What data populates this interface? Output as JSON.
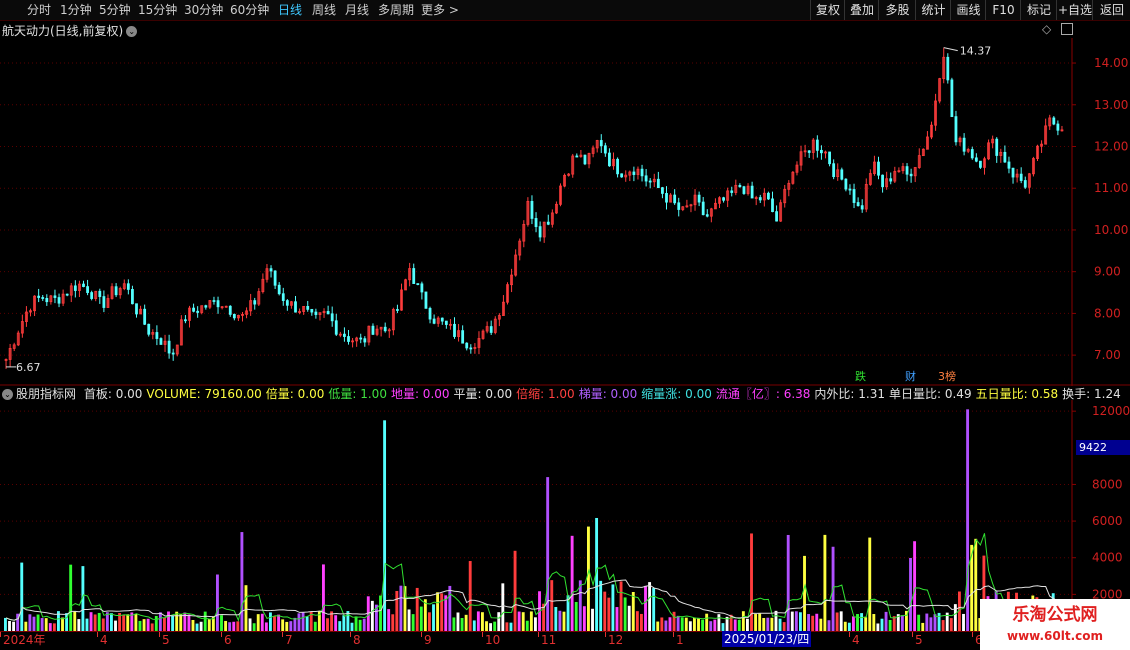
{
  "toolbar": {
    "periods": [
      "分时",
      "1分钟",
      "5分钟",
      "15分钟",
      "30分钟",
      "60分钟",
      "日线",
      "周线",
      "月线",
      "多周期",
      "更多 >"
    ],
    "active_period": "日线",
    "right_buttons": [
      "复权",
      "叠加",
      "多股",
      "统计",
      "画线",
      "F10",
      "标记",
      "+自选",
      "返回"
    ]
  },
  "stock": {
    "title": "航天动力(日线,前复权)",
    "high_label": "14.37",
    "low_label": "6.67"
  },
  "markers": [
    {
      "label": "跌",
      "color": "#30e030"
    },
    {
      "label": "财",
      "color": "#40a0ff"
    },
    {
      "label": "3榜",
      "color": "#ff8040"
    }
  ],
  "indicator": {
    "name": "股朋指标网",
    "fields": [
      {
        "label": "首板: 0.00",
        "color": "#e0e0e0"
      },
      {
        "label": "VOLUME: 79160.00",
        "color": "#ffff40"
      },
      {
        "label": "倍量: 0.00",
        "color": "#ffff40"
      },
      {
        "label": "低量: 1.00",
        "color": "#40e040"
      },
      {
        "label": "地量: 0.00",
        "color": "#ff40ff"
      },
      {
        "label": "平量: 0.00",
        "color": "#e0e0e0"
      },
      {
        "label": "倍缩: 1.00",
        "color": "#ff4040"
      },
      {
        "label": "梯量: 0.00",
        "color": "#b060ff"
      },
      {
        "label": "缩量涨: 0.00",
        "color": "#40e0e0"
      },
      {
        "label": "流通〖亿〗: 6.38",
        "color": "#ff40ff"
      },
      {
        "label": "内外比: 1.31",
        "color": "#e0e0e0"
      },
      {
        "label": "单日量比: 0.49",
        "color": "#e0e0e0"
      },
      {
        "label": "五日量比: 0.58",
        "color": "#ffff40"
      },
      {
        "label": "换手: 1.24",
        "color": "#e0e0e0"
      }
    ],
    "cursor_value": "9422"
  },
  "date_axis": {
    "labels": [
      "2024年",
      "4",
      "5",
      "6",
      "7",
      "8",
      "9",
      "10",
      "11",
      "12",
      "1",
      "2025/01/23/四",
      "4",
      "5",
      "6"
    ],
    "cursor_label": "2025/01/23/四"
  },
  "watermark": {
    "title": "乐淘公式网",
    "url": "www.60lt.com"
  },
  "chart_data": [
    {
      "type": "candlestick",
      "title": "航天动力(日线,前复权)",
      "y_ticks": [
        "14.00",
        "13.00",
        "12.00",
        "11.00",
        "10.00",
        "9.00",
        "8.00",
        "7.00"
      ],
      "ylim": [
        6.5,
        14.6
      ],
      "annotations": [
        {
          "text": "14.37",
          "kind": "high"
        },
        {
          "text": "6.67",
          "kind": "low"
        }
      ],
      "close_path": [
        6.9,
        7.6,
        8.2,
        8.4,
        8.3,
        8.5,
        8.7,
        8.6,
        8.2,
        8.5,
        8.7,
        8.1,
        7.6,
        7.4,
        7.0,
        7.9,
        8.1,
        8.2,
        8.3,
        8.1,
        7.9,
        8.3,
        9.1,
        8.5,
        8.2,
        8.1,
        7.8,
        8.0,
        7.6,
        7.4,
        7.3,
        7.7,
        7.6,
        8.1,
        9.1,
        8.4,
        7.9,
        7.7,
        7.5,
        7.3,
        7.4,
        7.7,
        8.4,
        9.5,
        10.6,
        10.0,
        10.4,
        11.3,
        11.8,
        11.6,
        12.2,
        11.6,
        11.4,
        11.5,
        11.2,
        11.0,
        10.7,
        10.4,
        10.7,
        10.3,
        10.6,
        10.8,
        11.1,
        10.7,
        10.8,
        10.2,
        11.3,
        11.7,
        12.1,
        11.9,
        11.3,
        11.1,
        10.4,
        11.6,
        11.0,
        11.5,
        11.3,
        11.8,
        12.5,
        14.37,
        12.1,
        12.0,
        11.6,
        12.1,
        11.8,
        11.3,
        11.1,
        11.9,
        12.6,
        12.5
      ],
      "volume_ticks": [
        "12000",
        "8000",
        "6000",
        "4000",
        "2000"
      ],
      "volume_ylim": [
        0,
        12500
      ],
      "volume_spikes": [
        5400,
        2500,
        11500,
        8400,
        5700,
        4100,
        5100,
        12100,
        4700,
        3200
      ]
    }
  ]
}
